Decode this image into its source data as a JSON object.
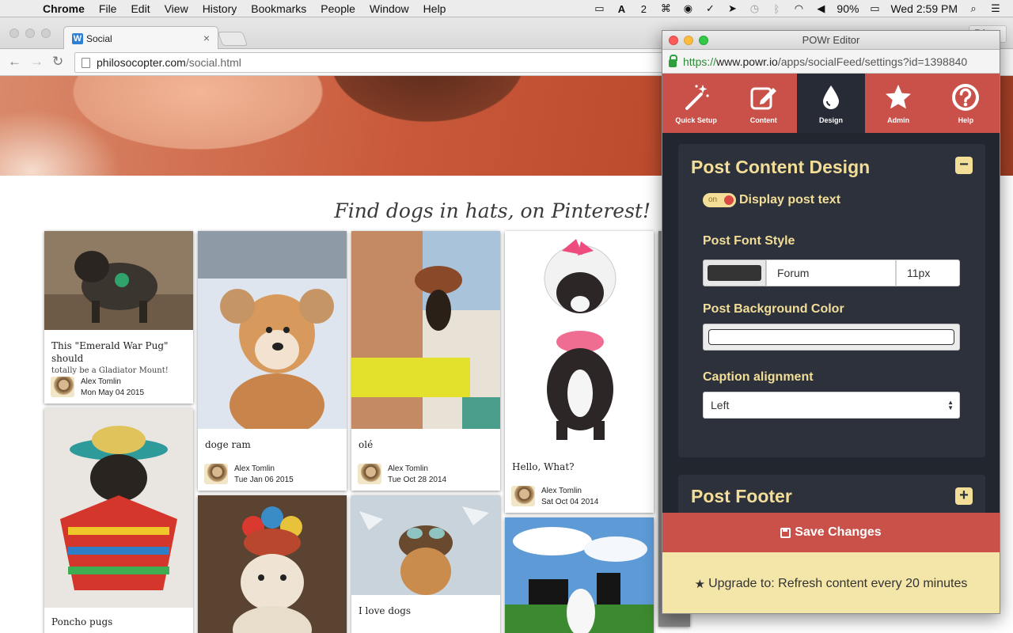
{
  "menubar": {
    "app": "Chrome",
    "items": [
      "File",
      "Edit",
      "View",
      "History",
      "Bookmarks",
      "People",
      "Window",
      "Help"
    ],
    "badge_count": "2",
    "battery": "90%",
    "clock": "Wed 2:59 PM"
  },
  "browser": {
    "tab_title": "Social",
    "tab_favicon": "W",
    "user_chip": "Eric",
    "url_host": "philosocopter.com",
    "url_path": "/social.html"
  },
  "page": {
    "heading": "Find dogs in hats, on Pinterest!",
    "cards": [
      {
        "caption": "This \"Emerald War Pug\" should",
        "sub": "totally be a Gladiator Mount!",
        "author": "Alex Tomlin",
        "date": "Mon May 04 2015"
      },
      {
        "caption": "doge ram",
        "author": "Alex Tomlin",
        "date": "Tue Jan 06 2015"
      },
      {
        "caption": "olé",
        "author": "Alex Tomlin",
        "date": "Tue Oct 28 2014"
      },
      {
        "caption": "Hello, What?",
        "author": "Alex Tomlin",
        "date": "Sat Oct 04 2014"
      },
      {
        "caption": "Poncho pugs"
      },
      {
        "caption": ""
      },
      {
        "caption": "I love dogs"
      },
      {
        "caption": ""
      }
    ]
  },
  "editor": {
    "window_title": "POWr Editor",
    "url_scheme": "https://",
    "url_host": "www.powr.io",
    "url_rest": "/apps/socialFeed/settings?id=1398840",
    "tabs": [
      {
        "label": "Quick Setup",
        "icon": "magic-wand-icon"
      },
      {
        "label": "Content",
        "icon": "edit-icon"
      },
      {
        "label": "Design",
        "icon": "drop-icon"
      },
      {
        "label": "Admin",
        "icon": "star-icon"
      },
      {
        "label": "Help",
        "icon": "help-icon"
      }
    ],
    "active_tab": "Design",
    "section1": {
      "title": "Post Content Design",
      "toggle": "−",
      "switch_on": "on",
      "display_text_label": "Display post text",
      "font_style_label": "Post Font Style",
      "font_color": "#333333",
      "font_name": "Forum",
      "font_size": "11px",
      "bg_color_label": "Post Background Color",
      "bg_color": "#ffffff",
      "caption_label": "Caption alignment",
      "caption_value": "Left"
    },
    "section2": {
      "title": "Post Footer",
      "toggle": "+"
    },
    "save_label": "Save Changes",
    "upgrade_label": "Upgrade to: Refresh content every 20 minutes"
  },
  "colors": {
    "accent_red": "#c9514a",
    "panel_gold": "#f3de98",
    "panel_dark": "#262b36"
  }
}
